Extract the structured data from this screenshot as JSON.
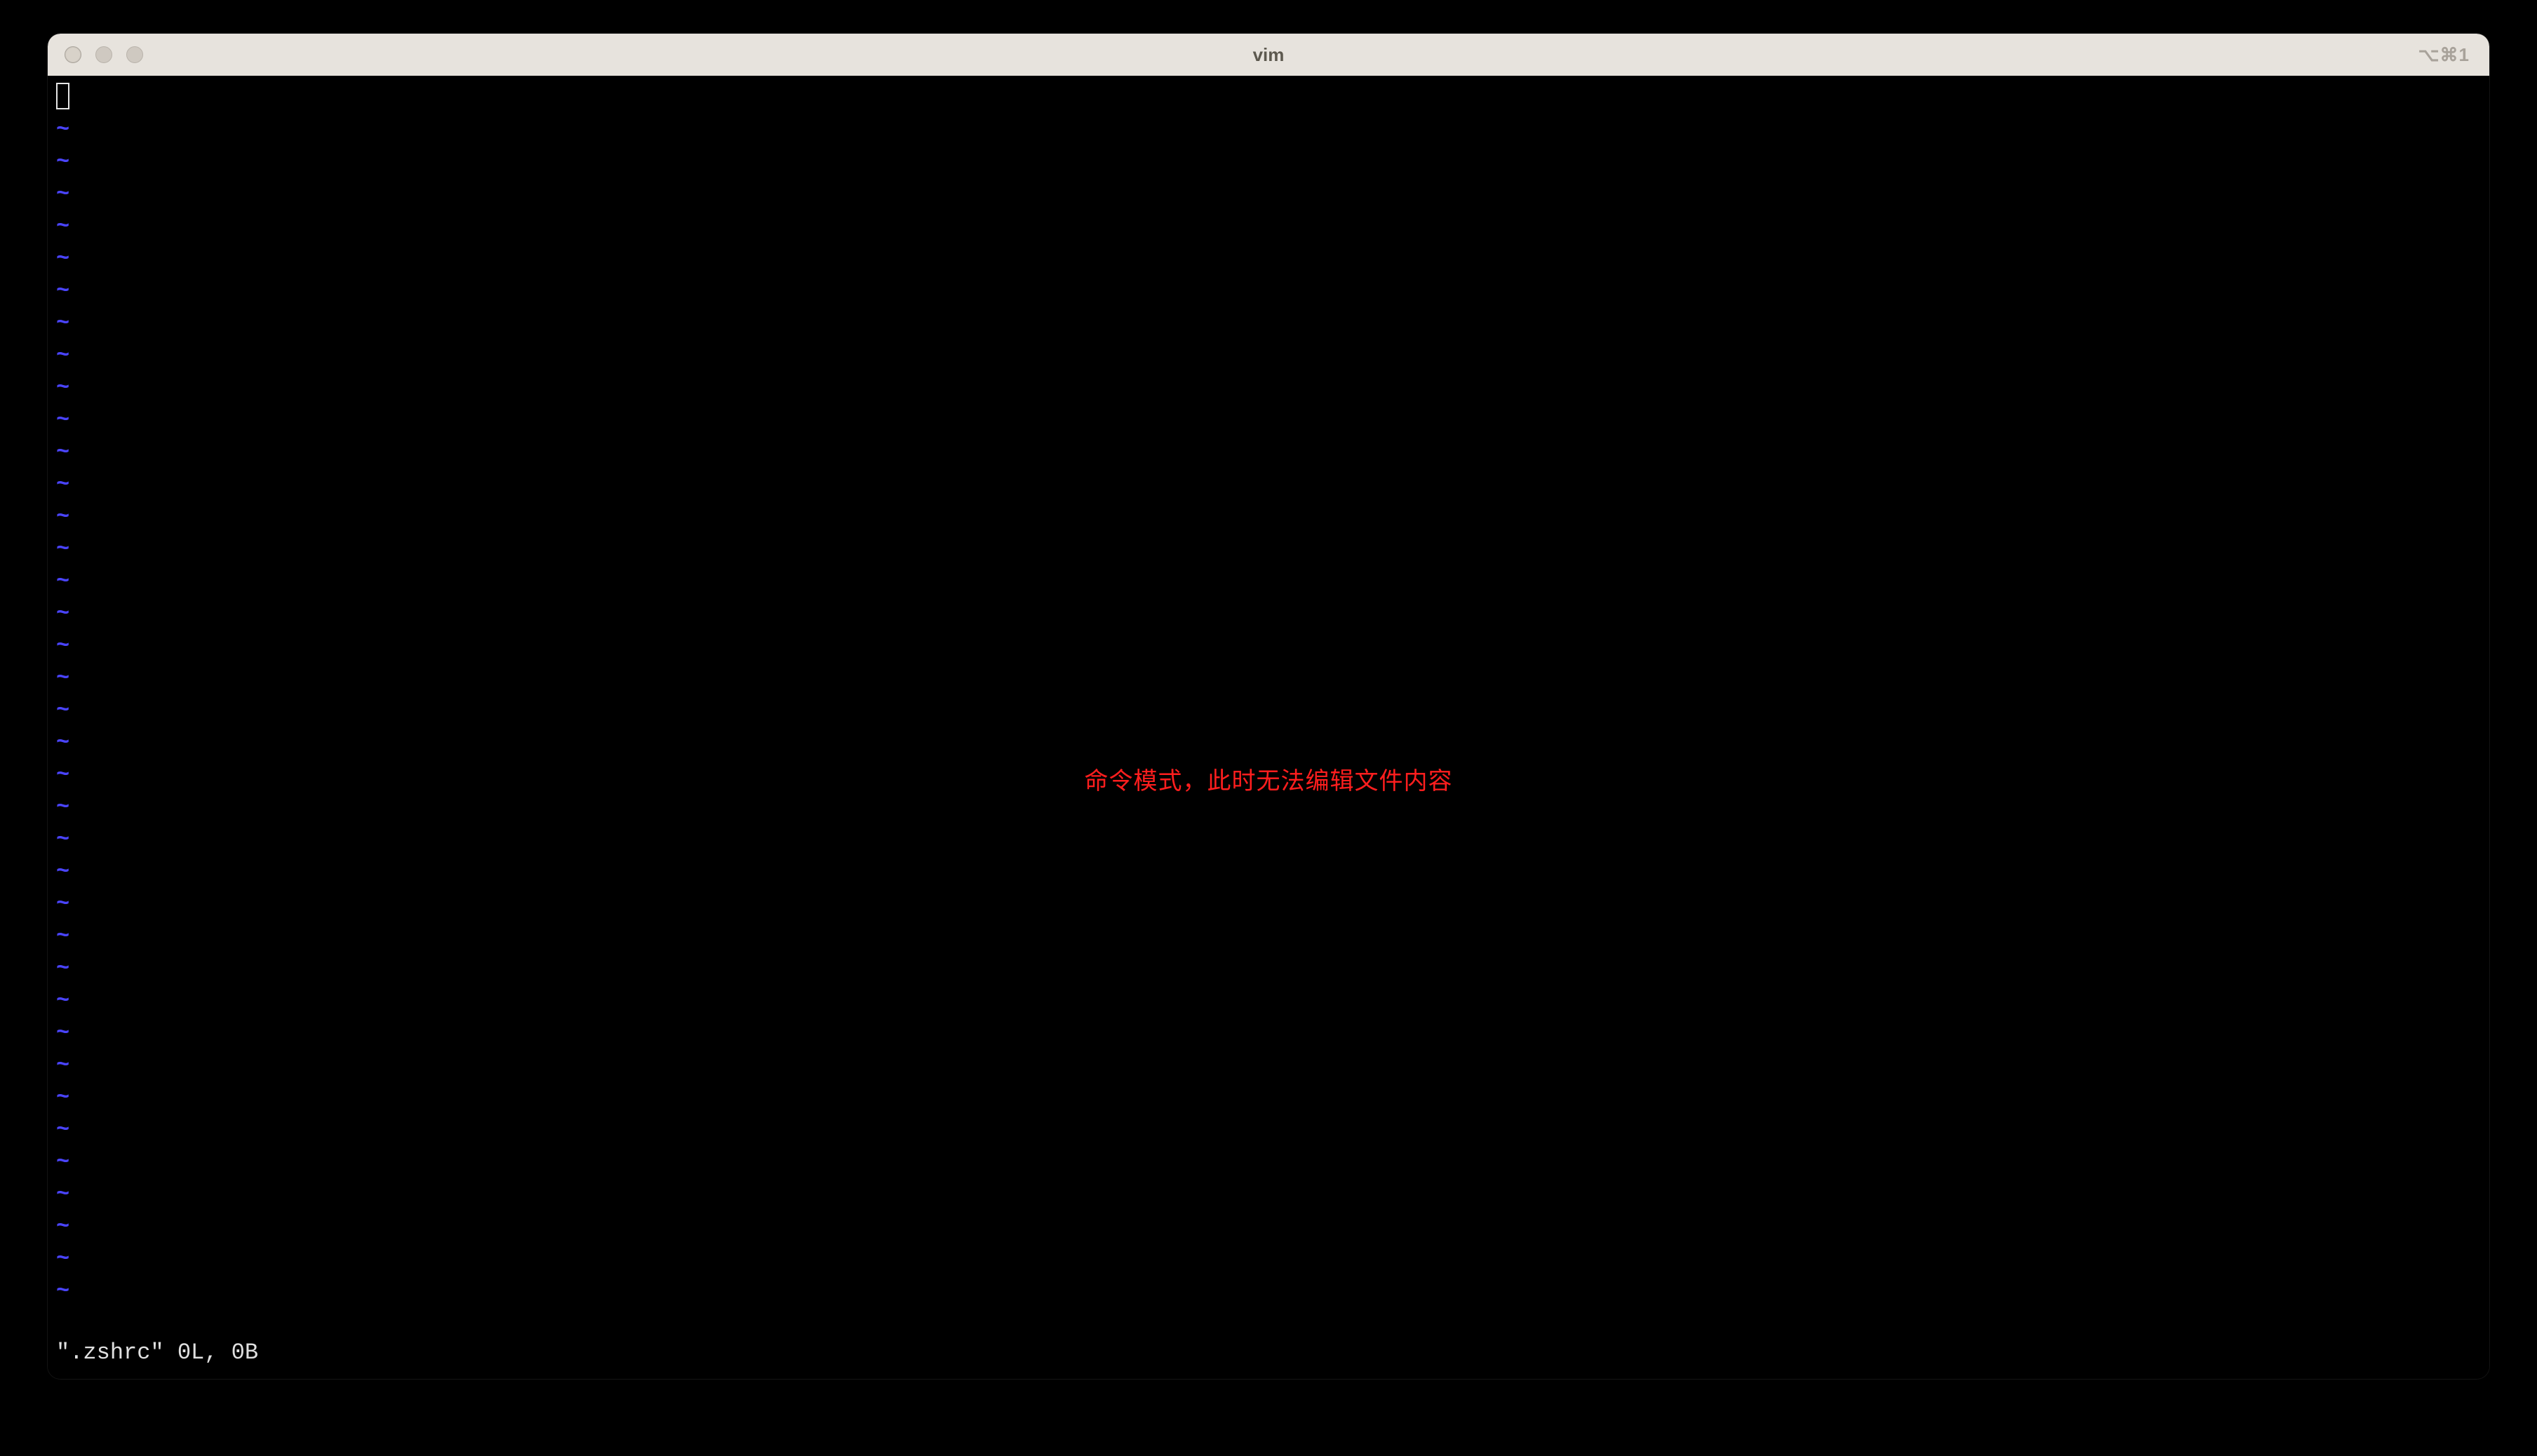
{
  "window": {
    "title": "vim",
    "tab_indicator": "⌥⌘1"
  },
  "editor": {
    "tilde_char": "~",
    "empty_line_count": 37,
    "annotation_text": "命令模式，此时无法编辑文件内容",
    "status_text": "\".zshrc\" 0L, 0B"
  }
}
